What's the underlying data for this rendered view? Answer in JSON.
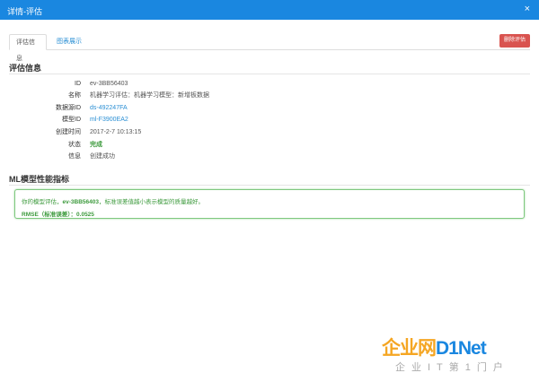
{
  "window": {
    "title": "详情-评估",
    "close_label": "×"
  },
  "tabs": [
    {
      "label": "评估信息"
    },
    {
      "label": "图表展示"
    }
  ],
  "actions": {
    "delete_label": "删除评估"
  },
  "evaluation_info": {
    "section_title": "评估信息",
    "rows": [
      {
        "label": "ID",
        "value": "ev-3BB56403"
      },
      {
        "label": "名称",
        "value": "机器学习评估：机器学习模型：新增板数据"
      },
      {
        "label": "数据源ID",
        "value": "ds-492247FA"
      },
      {
        "label": "模型ID",
        "value": "ml-F3900EA2"
      },
      {
        "label": "创建时间",
        "value": "2017-2-7 10:13:15"
      },
      {
        "label": "状态",
        "value": "完成"
      },
      {
        "label": "信息",
        "value": "创建成功"
      }
    ]
  },
  "metrics": {
    "section_title": "ML模型性能指标",
    "message_prefix": "你的模型评估，",
    "message_id": "ev-3BB56403",
    "message_suffix": "，标准误差值越小表示模型的质量越好。",
    "rmse_text": "RMSE（标准误差）：0.0525"
  },
  "watermark": {
    "brand_cn": "企业网",
    "brand_en": "D1Net",
    "tagline": "企业IT第1门户"
  },
  "colors": {
    "titlebar": "#1a87e0",
    "link": "#2a8fd4",
    "success": "#3c9a3c",
    "danger": "#d9534f"
  }
}
